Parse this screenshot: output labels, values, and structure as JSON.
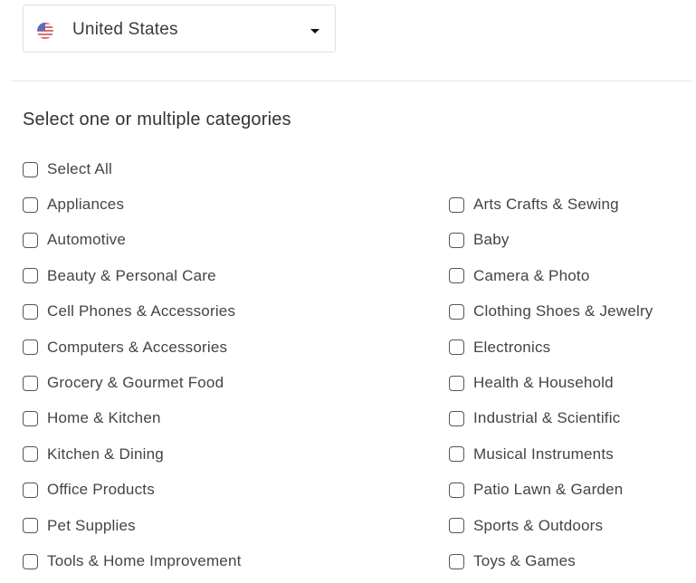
{
  "country_select": {
    "selected": "United States",
    "flag_icon": "us-flag-icon"
  },
  "heading": "Select one or multiple categories",
  "select_all": "Select All",
  "categories_left": [
    "Appliances",
    "Automotive",
    "Beauty & Personal Care",
    "Cell Phones & Accessories",
    "Computers & Accessories",
    "Grocery & Gourmet Food",
    "Home & Kitchen",
    "Kitchen & Dining",
    "Office Products",
    "Pet Supplies",
    "Tools & Home Improvement"
  ],
  "categories_right": [
    "Arts Crafts & Sewing",
    "Baby",
    "Camera & Photo",
    "Clothing Shoes & Jewelry",
    "Electronics",
    "Health & Household",
    "Industrial & Scientific",
    "Musical Instruments",
    "Patio Lawn & Garden",
    "Sports & Outdoors",
    "Toys & Games"
  ]
}
